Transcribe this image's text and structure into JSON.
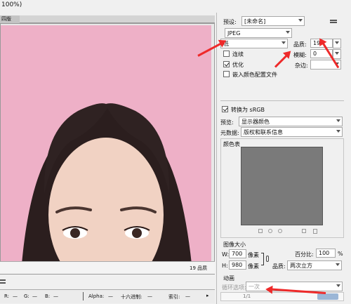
{
  "window": {
    "title_fragment": "100%)"
  },
  "tab": {
    "label": "四版"
  },
  "preview": {
    "quality_label": "19 品质"
  },
  "status_bar": {
    "r_label": "R:",
    "r_value": "—",
    "g_label": "G:",
    "g_value": "—",
    "b_label": "B:",
    "b_value": "—",
    "alpha_label": "Alpha:",
    "alpha_value": "—",
    "hex_label": "十六进制:",
    "hex_value": "—",
    "index_label": "索引:",
    "index_value": "—"
  },
  "settings": {
    "preset_label": "预设:",
    "preset_value": "[未命名]",
    "format_value": "JPEG",
    "quality_level_value": "低",
    "quality_label": "品质:",
    "quality_value": "19",
    "progressive_label": "连续",
    "progressive_checked": false,
    "blur_label": "模糊:",
    "blur_value": "0",
    "optimized_label": "优化",
    "optimized_checked": true,
    "matte_label": "杂边:",
    "embed_profile_label": "嵌入颜色配置文件",
    "embed_profile_checked": false,
    "convert_srgb_label": "转换为 sRGB",
    "convert_srgb_checked": true,
    "preview_label": "预览:",
    "preview_value": "显示器颜色",
    "metadata_label": "元数据:",
    "metadata_value": "版权和联系信息",
    "color_table_label": "颜色表",
    "image_size_label": "图像大小",
    "width_label": "W:",
    "width_value": "700",
    "height_label": "H:",
    "height_value": "980",
    "unit_pixels": "像素",
    "percent_label": "百分比:",
    "percent_value": "100",
    "percent_sign": "%",
    "quality_resample_label": "品质:",
    "quality_resample_value": "两次立方",
    "animation_label": "动画",
    "loop_label": "循环选项:",
    "loop_value": "一次",
    "frame_counter": "1/1"
  },
  "colors": {
    "preview_bg": "#eeb0c7",
    "swatch": "#7a7a7a",
    "accent_red": "#ee2a2a"
  }
}
